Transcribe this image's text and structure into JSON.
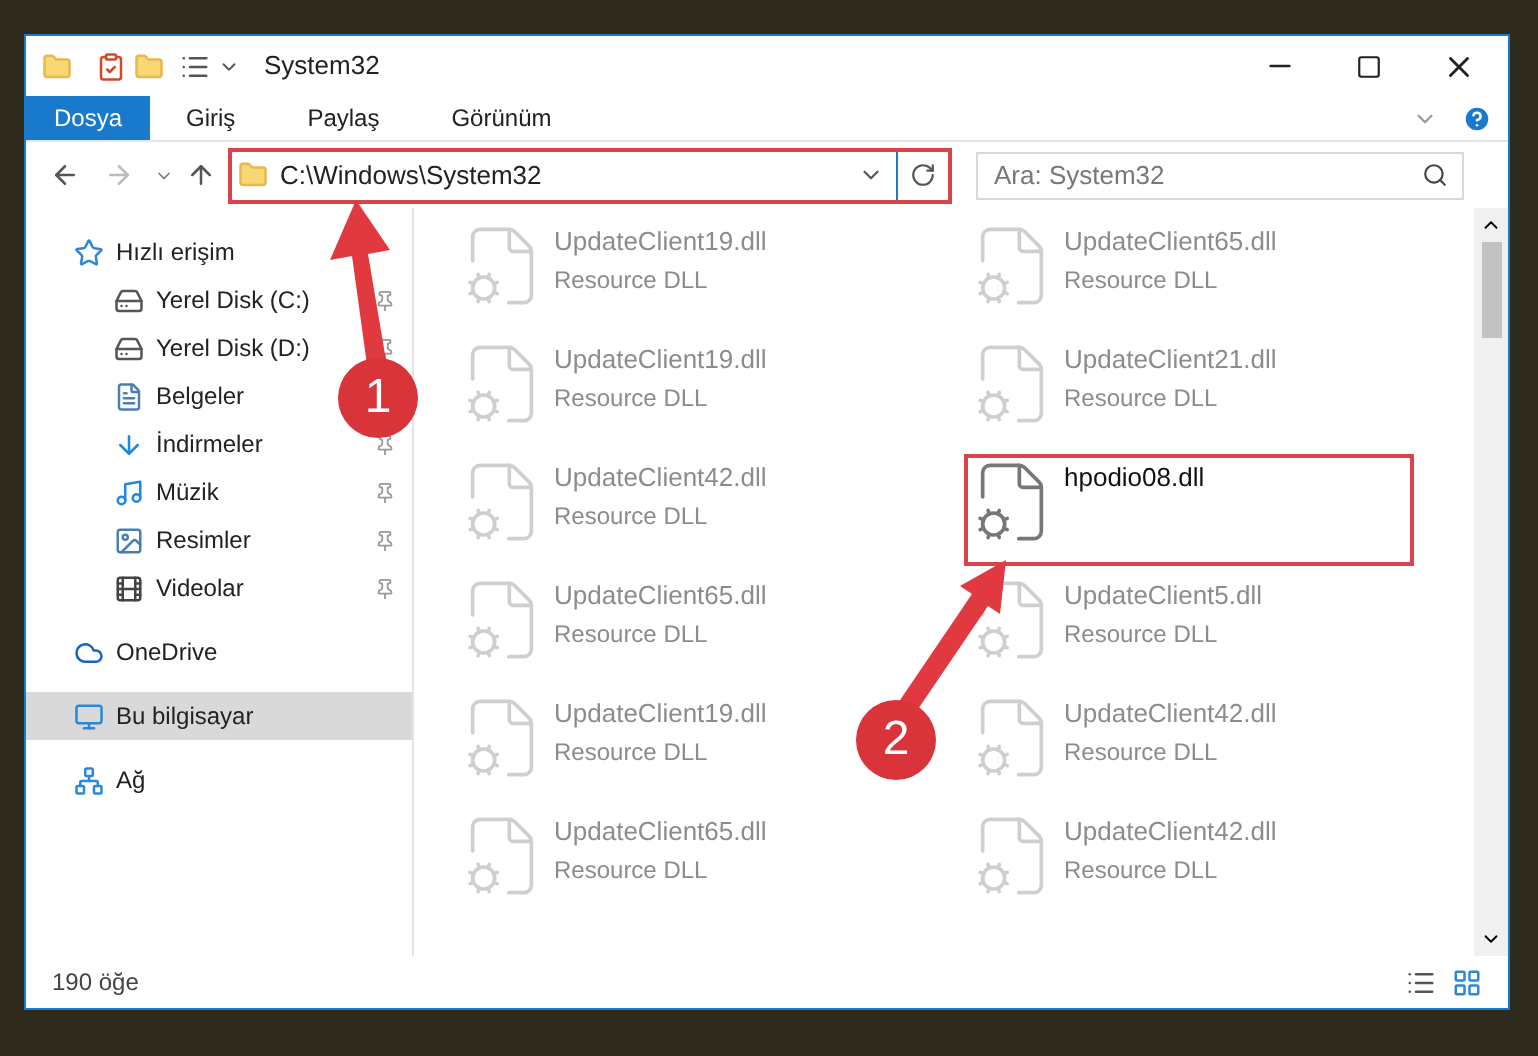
{
  "window": {
    "title": "System32"
  },
  "ribbon_tabs": [
    {
      "label": "Dosya",
      "selected": true
    },
    {
      "label": "Giriş",
      "selected": false
    },
    {
      "label": "Paylaş",
      "selected": false
    },
    {
      "label": "Görünüm",
      "selected": false
    }
  ],
  "address": {
    "path": "C:\\Windows\\System32",
    "highlighted": true
  },
  "search": {
    "placeholder": "Ara: System32"
  },
  "sidebar": {
    "items": [
      {
        "label": "Hızlı erişim",
        "kind": "star",
        "selected": false,
        "children": [
          {
            "label": "Yerel Disk (C:)",
            "kind": "drive",
            "pinned": true,
            "selected": false
          },
          {
            "label": "Yerel Disk (D:)",
            "kind": "drive",
            "pinned": true,
            "selected": false
          },
          {
            "label": "Belgeler",
            "kind": "document",
            "selected": false
          },
          {
            "label": "İndirmeler",
            "kind": "download",
            "pinned": true,
            "selected": false
          },
          {
            "label": "Müzik",
            "kind": "music",
            "pinned": true,
            "selected": false
          },
          {
            "label": "Resimler",
            "kind": "picture",
            "pinned": true,
            "selected": false
          },
          {
            "label": "Videolar",
            "kind": "video",
            "pinned": true,
            "selected": false
          }
        ]
      },
      {
        "label": "OneDrive",
        "kind": "cloud",
        "selected": false
      },
      {
        "label": "Bu bilgisayar",
        "kind": "computer",
        "selected": true
      },
      {
        "label": "Ağ",
        "kind": "network",
        "selected": false
      }
    ]
  },
  "files": [
    {
      "name": "UpdateClient19.dll",
      "type": "Resource DLL",
      "faded": true,
      "highlighted": false
    },
    {
      "name": "UpdateClient65.dll",
      "type": "Resource DLL",
      "faded": true,
      "highlighted": false
    },
    {
      "name": "UpdateClient19.dll",
      "type": "Resource DLL",
      "faded": true,
      "highlighted": false
    },
    {
      "name": "UpdateClient21.dll",
      "type": "Resource DLL",
      "faded": true,
      "highlighted": false
    },
    {
      "name": "UpdateClient42.dll",
      "type": "Resource DLL",
      "faded": true,
      "highlighted": false
    },
    {
      "name": "hpodio08.dll",
      "faded": false,
      "highlighted": true
    },
    {
      "name": "UpdateClient65.dll",
      "type": "Resource DLL",
      "faded": true,
      "highlighted": false
    },
    {
      "name": "UpdateClient5.dll",
      "type": "Resource DLL",
      "faded": true,
      "highlighted": false
    },
    {
      "name": "UpdateClient19.dll",
      "type": "Resource DLL",
      "faded": true,
      "highlighted": false
    },
    {
      "name": "UpdateClient42.dll",
      "type": "Resource DLL",
      "faded": true,
      "highlighted": false
    },
    {
      "name": "UpdateClient65.dll",
      "type": "Resource DLL",
      "faded": true,
      "highlighted": false
    },
    {
      "name": "UpdateClient42.dll",
      "type": "Resource DLL",
      "faded": true,
      "highlighted": false
    }
  ],
  "status_bar": {
    "count": "190 öğe"
  },
  "annotations": [
    {
      "label": "1"
    },
    {
      "label": "2"
    }
  ]
}
